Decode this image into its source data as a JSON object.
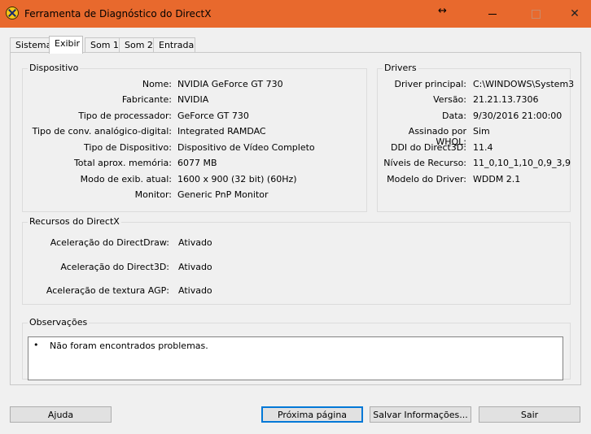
{
  "window": {
    "title": "Ferramenta de Diagnóstico do DirectX",
    "move_glyph": "↔",
    "close_glyph": "✕"
  },
  "tabs": [
    {
      "label": "Sistema"
    },
    {
      "label": "Exibir",
      "active": true
    },
    {
      "label": "Som 1"
    },
    {
      "label": "Som 2"
    },
    {
      "label": "Entrada"
    }
  ],
  "device": {
    "title": "Dispositivo",
    "rows": [
      {
        "label": "Nome:",
        "value": "NVIDIA GeForce GT 730"
      },
      {
        "label": "Fabricante:",
        "value": "NVIDIA"
      },
      {
        "label": "Tipo de processador:",
        "value": "GeForce GT 730"
      },
      {
        "label": "Tipo de conv. analógico-digital:",
        "value": "Integrated RAMDAC"
      },
      {
        "label": "Tipo de Dispositivo:",
        "value": "Dispositivo de Vídeo Completo"
      },
      {
        "label": "Total aprox. memória:",
        "value": "6077 MB"
      },
      {
        "label": "Modo de exib. atual:",
        "value": "1600 x 900 (32 bit) (60Hz)"
      },
      {
        "label": "Monitor:",
        "value": "Generic PnP Monitor"
      }
    ]
  },
  "drivers": {
    "title": "Drivers",
    "rows": [
      {
        "label": "Driver principal:",
        "value": "C:\\WINDOWS\\System3"
      },
      {
        "label": "Versão:",
        "value": "21.21.13.7306"
      },
      {
        "label": "Data:",
        "value": "9/30/2016 21:00:00"
      },
      {
        "label": "Assinado por WHQL:",
        "value": "Sim"
      },
      {
        "label": "DDI do Direct3D:",
        "value": "11.4"
      },
      {
        "label": "Níveis de Recurso:",
        "value": "11_0,10_1,10_0,9_3,9"
      },
      {
        "label": "Modelo do Driver:",
        "value": "WDDM 2.1"
      }
    ]
  },
  "directx": {
    "title": "Recursos do DirectX",
    "rows": [
      {
        "label": "Aceleração do DirectDraw:",
        "value": "Ativado"
      },
      {
        "label": "Aceleração do Direct3D:",
        "value": "Ativado"
      },
      {
        "label": "Aceleração de textura AGP:",
        "value": "Ativado"
      }
    ]
  },
  "notes": {
    "title": "Observações",
    "bullet": "•",
    "text": "Não foram encontrados problemas."
  },
  "buttons": {
    "help": "Ajuda",
    "next": "Próxima página",
    "save": "Salvar Informações...",
    "exit": "Sair"
  }
}
